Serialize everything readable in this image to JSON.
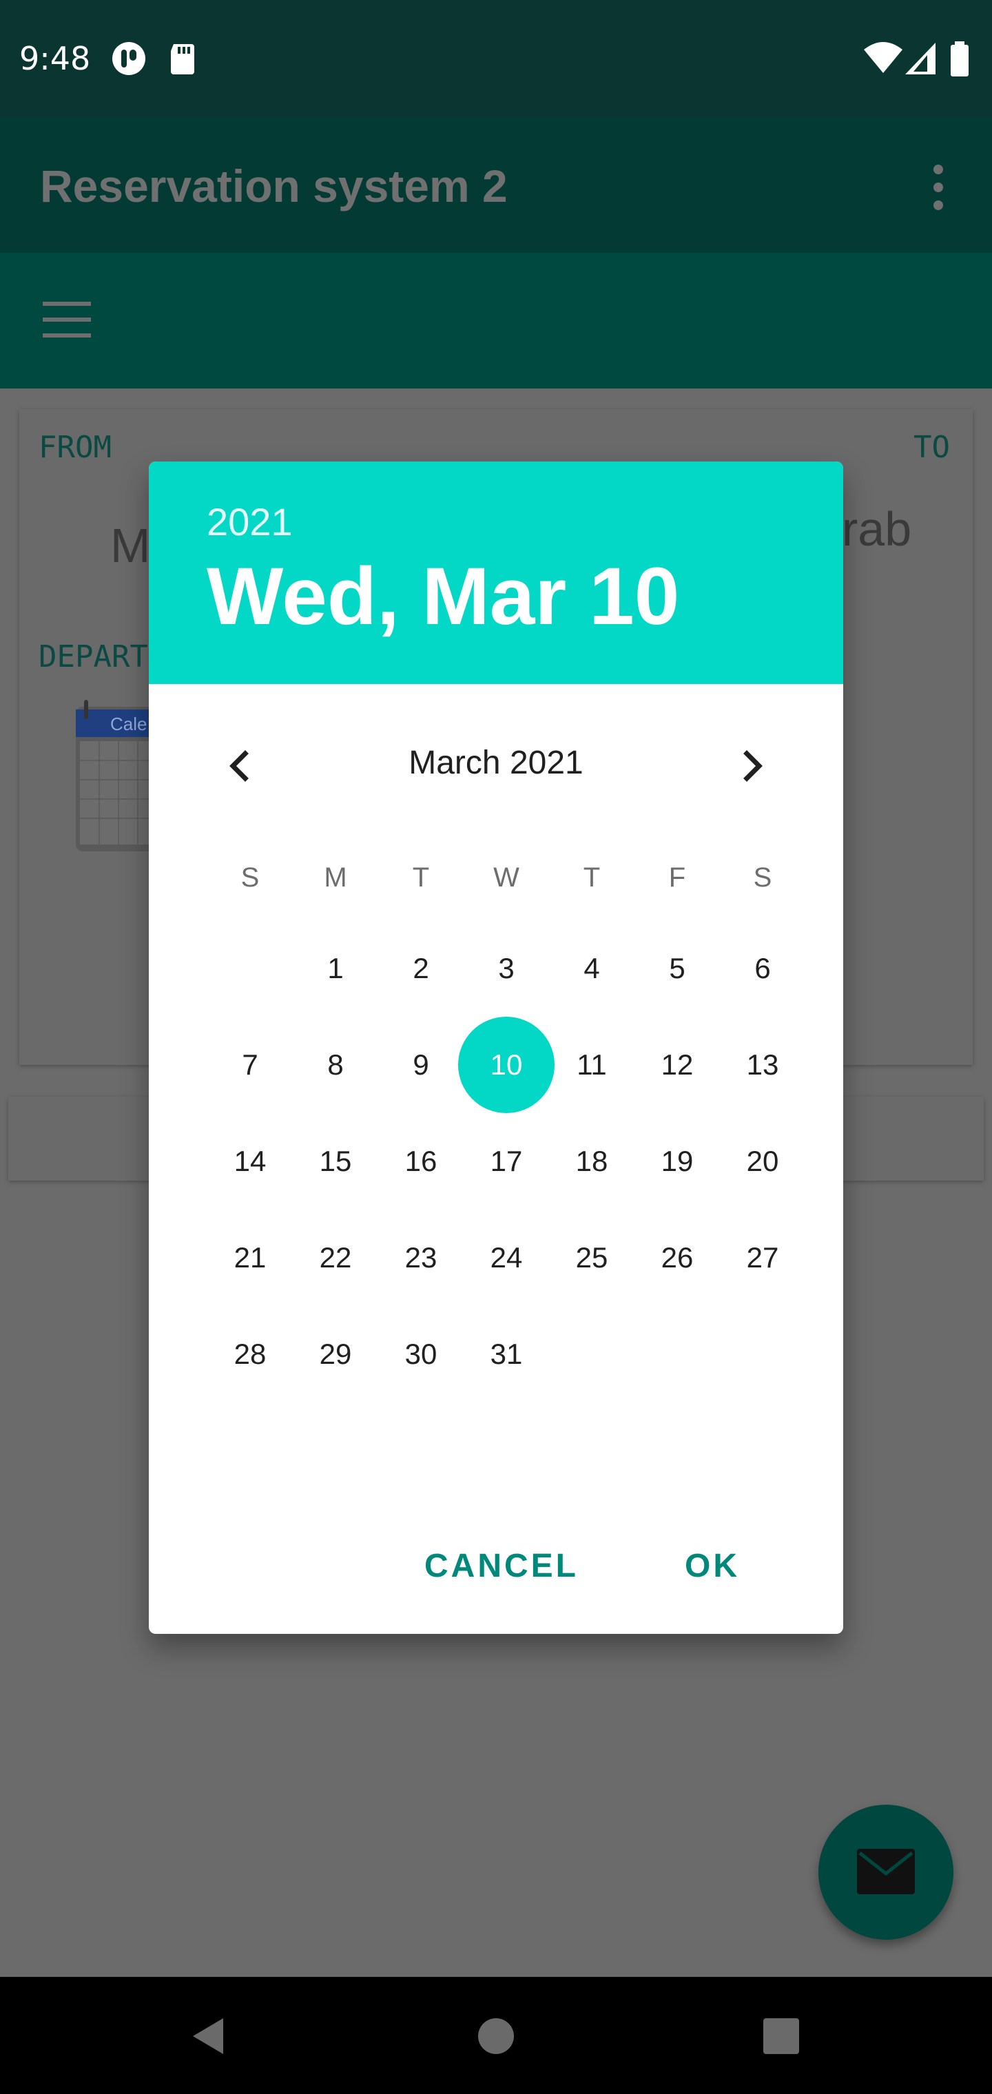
{
  "status_bar": {
    "time": "9:48"
  },
  "app_bar": {
    "title": "Reservation system 2"
  },
  "background_form": {
    "from_label": "FROM",
    "to_label": "TO",
    "from_value": "M",
    "to_value": "rab",
    "depart_label": "DEPART",
    "calendar_image_label": "Cale"
  },
  "date_picker": {
    "year": "2021",
    "selected_date": "Wed, Mar 10",
    "month_label": "March 2021",
    "weekdays": [
      "S",
      "M",
      "T",
      "W",
      "T",
      "F",
      "S"
    ],
    "weeks": [
      [
        "",
        "1",
        "2",
        "3",
        "4",
        "5",
        "6"
      ],
      [
        "7",
        "8",
        "9",
        "10",
        "11",
        "12",
        "13"
      ],
      [
        "14",
        "15",
        "16",
        "17",
        "18",
        "19",
        "20"
      ],
      [
        "21",
        "22",
        "23",
        "24",
        "25",
        "26",
        "27"
      ],
      [
        "28",
        "29",
        "30",
        "31",
        "",
        "",
        ""
      ]
    ],
    "selected_day": "10",
    "cancel_label": "CANCEL",
    "ok_label": "OK",
    "accent_color": "#03d7c6"
  }
}
